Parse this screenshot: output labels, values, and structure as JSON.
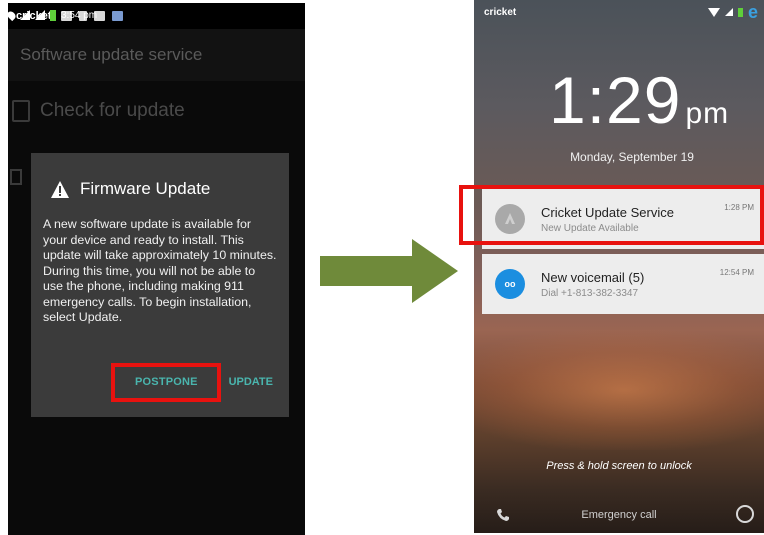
{
  "left_phone": {
    "status_bar": {
      "carrier": "cricket",
      "time": "3:54 pm"
    },
    "app_title": "Software update service",
    "check_update_label": "Check for update",
    "dialog": {
      "title": "Firmware Update",
      "body": "A new software update is available for your device and ready to install. This update will take approximately 10 minutes. During this time, you will not be able to use the phone, including making 911 emergency calls. To begin installation, select Update.",
      "postpone_label": "POSTPONE",
      "update_label": "UPDATE"
    }
  },
  "right_phone": {
    "status_bar": {
      "carrier": "cricket",
      "data_badge": "e"
    },
    "clock": {
      "time": "1:29",
      "ampm": "pm"
    },
    "date": "Monday, September 19",
    "notifications": [
      {
        "title": "Cricket Update Service",
        "subtitle": "New Update Available",
        "time": "1:28 PM",
        "icon": "cricket-icon"
      },
      {
        "title": "New voicemail (5)",
        "subtitle": "Dial +1-813-382-3347",
        "time": "12:54 PM",
        "icon": "voicemail-icon",
        "icon_glyph": "oo"
      }
    ],
    "unlock_hint": "Press & hold screen to unlock",
    "emergency_label": "Emergency call"
  },
  "colors": {
    "highlight": "#e8120f",
    "accent": "#4ab5ae",
    "arrow": "#6f8a3a",
    "voicemail": "#1b8ee0"
  }
}
